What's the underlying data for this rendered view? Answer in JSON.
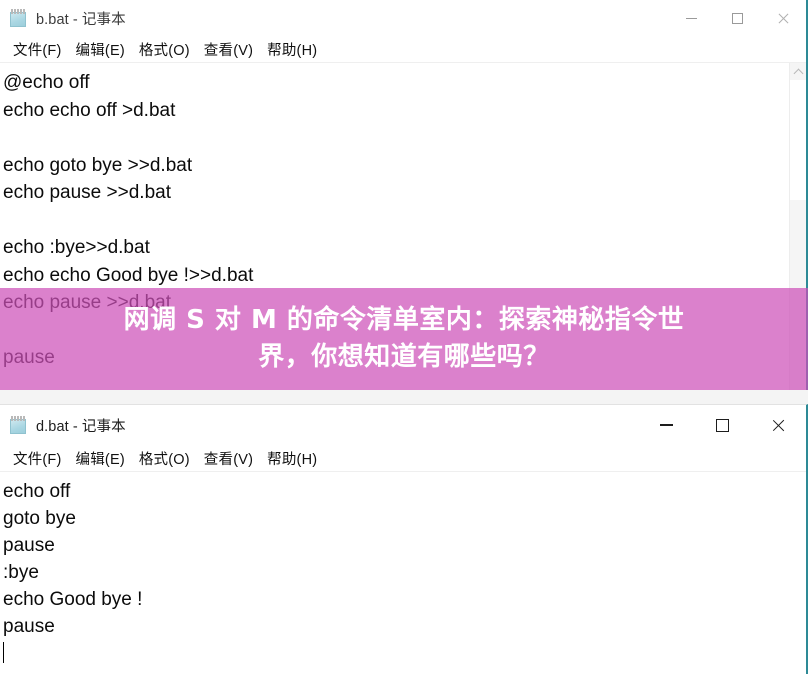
{
  "windows": [
    {
      "id": "b",
      "title": "b.bat - 记事本",
      "icon": "notepad-icon",
      "menu": [
        "文件(F)",
        "编辑(E)",
        "格式(O)",
        "查看(V)",
        "帮助(H)"
      ],
      "controls": {
        "minimize": "—",
        "maximize": "□",
        "close": "✕"
      },
      "content_lines": [
        "@echo off",
        "echo echo off >d.bat",
        "",
        "echo goto bye >>d.bat",
        "echo pause >>d.bat",
        "",
        "echo :bye>>d.bat",
        "echo echo Good bye !>>d.bat",
        "echo pause >>d.bat",
        "",
        "pause"
      ],
      "scrollbar": {
        "up_arrow": "▲"
      }
    },
    {
      "id": "d",
      "title": "d.bat - 记事本",
      "icon": "notepad-icon",
      "menu": [
        "文件(F)",
        "编辑(E)",
        "格式(O)",
        "查看(V)",
        "帮助(H)"
      ],
      "controls": {
        "minimize": "—",
        "maximize": "□",
        "close": "✕"
      },
      "content_lines": [
        "echo off",
        "goto bye",
        "pause",
        ":bye",
        "echo Good bye !",
        "pause"
      ]
    }
  ],
  "banner": {
    "line1": "网调 S 对 M 的命令清单室内：探索神秘指令世",
    "line2": "界，你想知道有哪些吗？",
    "background_color": "#cd50b9",
    "text_color": "#ffffff"
  },
  "colors": {
    "window_border": "#2d8a96",
    "page_background": "#f2f2f2",
    "text": "#0b0b0b"
  }
}
